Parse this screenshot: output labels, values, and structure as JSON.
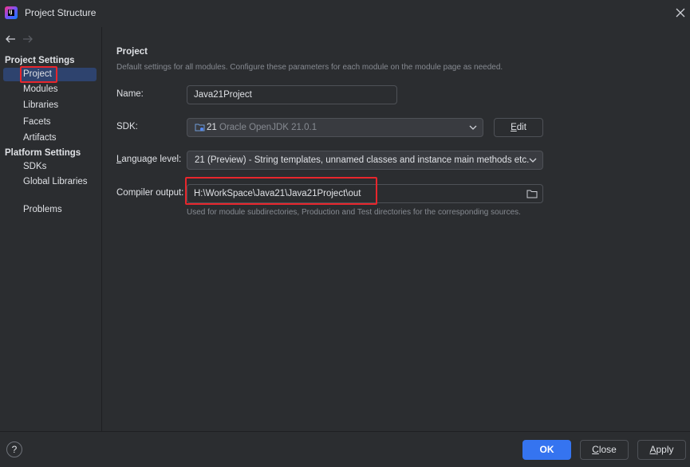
{
  "window": {
    "title": "Project Structure"
  },
  "sidebar": {
    "groups": [
      {
        "label": "Project Settings"
      },
      {
        "label": "Platform Settings"
      }
    ],
    "items": [
      {
        "label": "Project"
      },
      {
        "label": "Modules"
      },
      {
        "label": "Libraries"
      },
      {
        "label": "Facets"
      },
      {
        "label": "Artifacts"
      },
      {
        "label": "SDKs"
      },
      {
        "label": "Global Libraries"
      },
      {
        "label": "Problems"
      }
    ],
    "selected": "Project"
  },
  "main": {
    "title": "Project",
    "description": "Default settings for all modules. Configure these parameters for each module on the module page as needed.",
    "name": {
      "label": "Name:",
      "value": "Java21Project"
    },
    "sdk": {
      "label": "SDK:",
      "version": "21",
      "name": "Oracle OpenJDK 21.0.1",
      "edit_label_prefix": "",
      "edit_label_mnemonic": "E",
      "edit_label_rest": "dit"
    },
    "language_level": {
      "label_mnemonic": "L",
      "label_rest": "anguage level:",
      "value": "21 (Preview) - String templates, unnamed classes and instance main methods etc."
    },
    "compiler_output": {
      "label": "Compiler output:",
      "value": "H:\\WorkSpace\\Java21\\Java21Project\\out",
      "hint": "Used for module subdirectories, Production and Test directories for the corresponding sources."
    }
  },
  "footer": {
    "help": "?",
    "ok": "OK",
    "close_mnemonic": "C",
    "close_rest": "lose",
    "apply_mnemonic": "A",
    "apply_rest": "pply"
  },
  "colors": {
    "background": "#2b2d30",
    "selection": "#2e436e",
    "primary_button": "#3574f0",
    "highlight_annotation": "#e8262c"
  }
}
